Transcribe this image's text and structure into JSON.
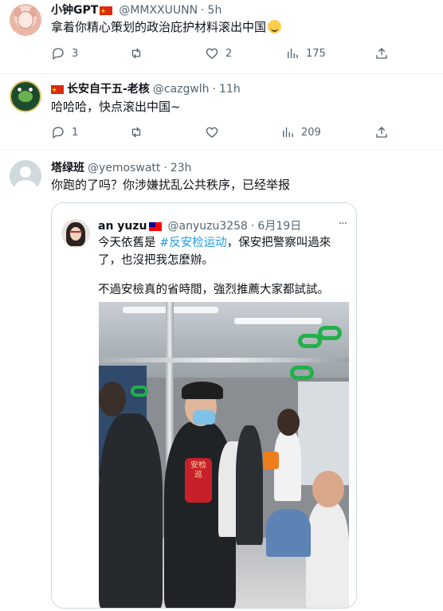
{
  "tweets": [
    {
      "name": "小钟GPT",
      "handle": "@MMXXUUNN",
      "sep": "·",
      "time": "5h",
      "text": "拿着你精心策划的政治庇护材料滚出中国",
      "emoji": "sweat-smile-emoji",
      "replies": "3",
      "retweets": "",
      "likes": "2",
      "views": "175"
    },
    {
      "name": "长安自干五-老核",
      "handle": "@cazgwlh",
      "sep": "·",
      "time": "11h",
      "text": "哈哈哈，快点滚出中国~",
      "replies": "1",
      "retweets": "",
      "likes": "",
      "views": "209"
    },
    {
      "name": "塔绿班",
      "handle": "@yemoswatt",
      "sep": "·",
      "time": "23h",
      "text": "你跑的了吗？你涉嫌扰乱公共秩序，已经举报"
    }
  ],
  "quote": {
    "name": "an yuzu",
    "handle": "@anyuzu3258",
    "sep": "·",
    "date": "6月19日",
    "more": "···",
    "line1_pre": "今天依舊是 ",
    "line1_link": "#反安检运动",
    "line1_post": "，保安把警察叫過來",
    "line2": "了，也沒把我怎麼辦。",
    "line3": "不過安檢真的省時間，強烈推薦大家都試試。",
    "armband_text": "安检巡"
  },
  "colors": {
    "accent": "#1d9bf0",
    "text": "#0f1419",
    "muted": "#536471",
    "border": "#cfd9de"
  }
}
